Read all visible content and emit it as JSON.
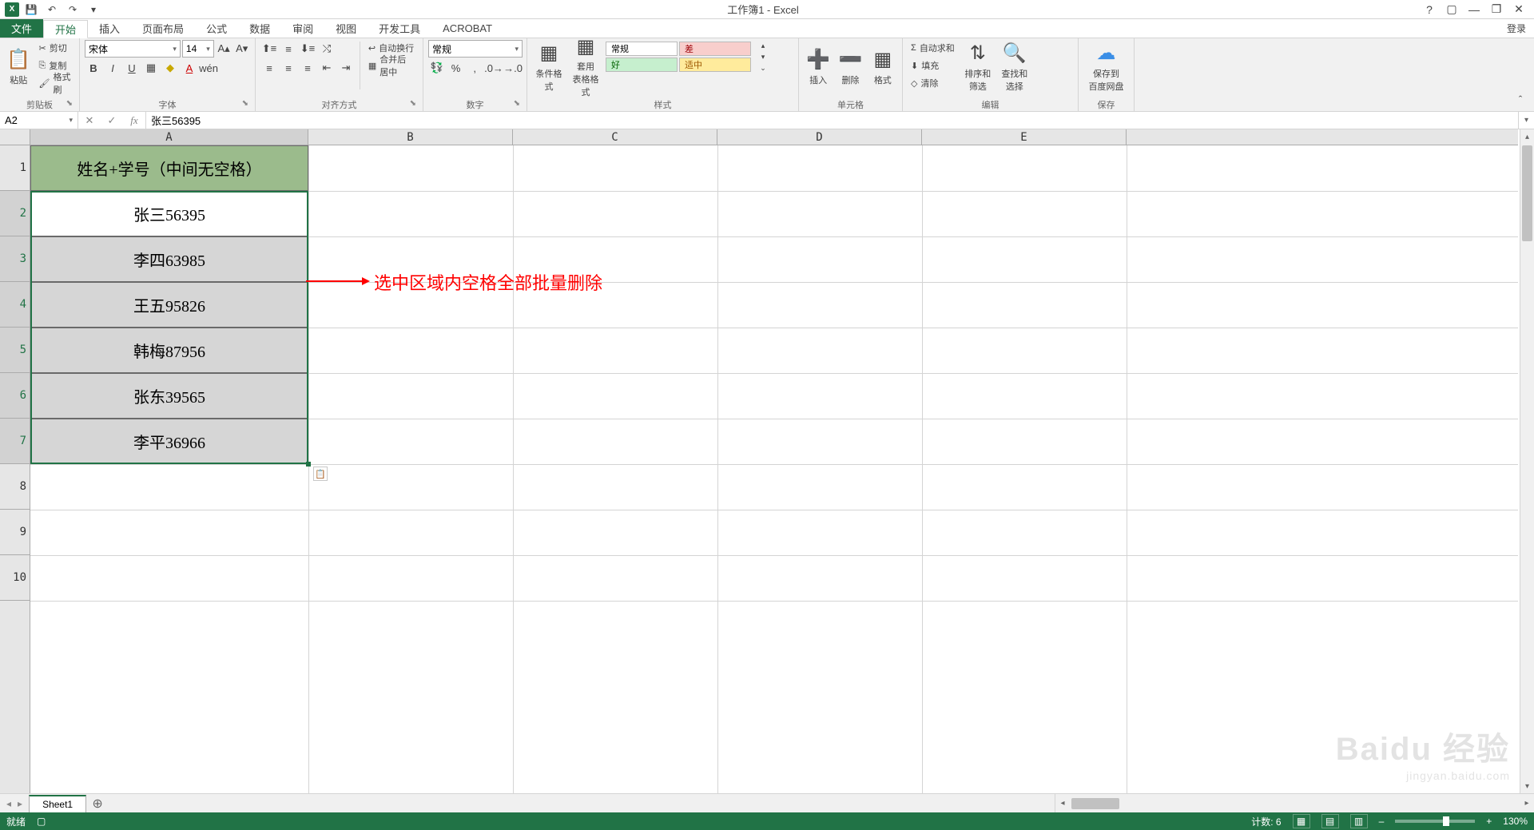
{
  "app": {
    "title": "工作簿1 - Excel",
    "login": "登录"
  },
  "qat": {
    "save": "保存",
    "undo": "撤销",
    "redo": "重做"
  },
  "tabs": {
    "file": "文件",
    "home": "开始",
    "insert": "插入",
    "layout": "页面布局",
    "formulas": "公式",
    "data": "数据",
    "review": "审阅",
    "view": "视图",
    "dev": "开发工具",
    "acrobat": "ACROBAT"
  },
  "ribbon": {
    "clipboard": {
      "paste": "粘贴",
      "cut": "剪切",
      "copy": "复制",
      "painter": "格式刷",
      "label": "剪贴板"
    },
    "font": {
      "name": "宋体",
      "size": "14",
      "label": "字体"
    },
    "align": {
      "wrap": "自动换行",
      "merge": "合并后居中",
      "label": "对齐方式"
    },
    "number": {
      "format": "常规",
      "label": "数字"
    },
    "styles": {
      "cond": "条件格式",
      "table": "套用\n表格格式",
      "normal": "常规",
      "bad": "差",
      "good": "好",
      "neutral": "适中",
      "label": "样式"
    },
    "cells": {
      "insert": "插入",
      "delete": "删除",
      "format": "格式",
      "label": "单元格"
    },
    "edit": {
      "sum": "自动求和",
      "fill": "填充",
      "clear": "清除",
      "sort": "排序和筛选",
      "find": "查找和选择",
      "label": "编辑"
    },
    "save": {
      "cloud": "保存到\n百度网盘",
      "label": "保存"
    }
  },
  "fbar": {
    "name": "A2",
    "formula": "张三56395"
  },
  "cols": [
    "A",
    "B",
    "C",
    "D",
    "E"
  ],
  "rows": [
    "1",
    "2",
    "3",
    "4",
    "5",
    "6",
    "7",
    "8",
    "9",
    "10"
  ],
  "data": {
    "header": "姓名+学号（中间无空格）",
    "r2": "张三56395",
    "r3": "李四63985",
    "r4": "王五95826",
    "r5": "韩梅87956",
    "r6": "张东39565",
    "r7": "李平36966"
  },
  "annotation": "选中区域内空格全部批量删除",
  "sheet": {
    "name": "Sheet1"
  },
  "status": {
    "ready": "就绪",
    "count": "计数: 6",
    "zoom": "130%"
  },
  "watermark": {
    "main": "Baidu 经验",
    "sub": "jingyan.baidu.com"
  }
}
